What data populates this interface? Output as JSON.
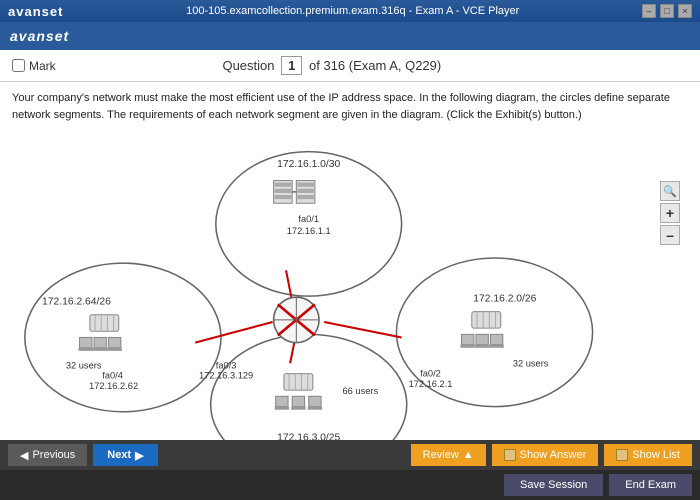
{
  "titlebar": {
    "logo_van": "van",
    "logo_set": "set",
    "title": "100-105.examcollection.premium.exam.316q - Exam A - VCE Player",
    "btn_min": "–",
    "btn_max": "□",
    "btn_close": "×"
  },
  "header": {
    "logo_a": "a",
    "logo_van": "van",
    "logo_set": "set"
  },
  "question_bar": {
    "mark_label": "Mark",
    "question_label": "Question",
    "question_number": "1",
    "question_total": "of 316 (Exam A, Q229)"
  },
  "question_text": "Your company's network must make the most efficient use of the IP address space. In the following diagram, the circles define separate network segments. The requirements of each network segment are given in the diagram. (Click the Exhibit(s) button.)",
  "diagram": {
    "top_network": "172.16.1.0/30",
    "top_interface": "fa0/1",
    "top_ip": "172.16.1.1",
    "left_network": "172.16.2.64/26",
    "left_interface": "fa0/4",
    "left_ip": "172.16.2.62",
    "left_users": "32 users",
    "right_network": "172.16.2.0/26",
    "right_interface": "fa0/2",
    "right_ip": "172.16.2.1",
    "right_users": "32 users",
    "bottom_interface": "fa0/3",
    "bottom_ip": "172.16.3.129",
    "bottom_users": "66 users",
    "bottom_network": "172.16.3.0/25"
  },
  "toolbar": {
    "prev_label": "Previous",
    "next_label": "Next",
    "review_label": "Review",
    "show_answer_label": "Show Answer",
    "show_list_label": "Show List"
  },
  "footer": {
    "save_session_label": "Save Session",
    "end_exam_label": "End Exam"
  },
  "zoom": {
    "plus": "+",
    "minus": "–"
  }
}
